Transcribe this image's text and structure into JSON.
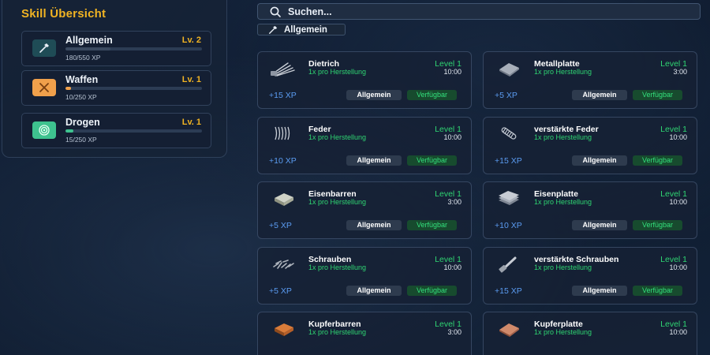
{
  "skills_panel": {
    "title": "Skill Übersicht",
    "skills": [
      {
        "name": "Allgemein",
        "level": "Lv. 2",
        "xp": "180/550 XP",
        "progress": 0.33,
        "icon": "hammer-icon",
        "icon_bg": "#1f4c56",
        "bar_color": "#3a4a60"
      },
      {
        "name": "Waffen",
        "level": "Lv. 1",
        "xp": "10/250 XP",
        "progress": 0.04,
        "icon": "crossed-swords-icon",
        "icon_bg": "#f0a04b",
        "bar_color": "#f0a04b"
      },
      {
        "name": "Drogen",
        "level": "Lv. 1",
        "xp": "15/250 XP",
        "progress": 0.06,
        "icon": "spiral-icon",
        "icon_bg": "#3ec28f",
        "bar_color": "#3ec28f"
      }
    ]
  },
  "search": {
    "placeholder": "Suchen..."
  },
  "filter": {
    "label": "Allgemein"
  },
  "items": [
    {
      "name": "Dietrich",
      "level": "Level 1",
      "per": "1x pro Herstellung",
      "time": "10:00",
      "xp": "+15 XP",
      "category": "Allgemein",
      "status": "Verfügbar",
      "thumb": "lockpick"
    },
    {
      "name": "Metallplatte",
      "level": "Level 1",
      "per": "1x pro Herstellung",
      "time": "3:00",
      "xp": "+5 XP",
      "category": "Allgemein",
      "status": "Verfügbar",
      "thumb": "plate"
    },
    {
      "name": "Feder",
      "level": "Level 1",
      "per": "1x pro Herstellung",
      "time": "10:00",
      "xp": "+10 XP",
      "category": "Allgemein",
      "status": "Verfügbar",
      "thumb": "spring"
    },
    {
      "name": "verstärkte Feder",
      "level": "Level 1",
      "per": "1x pro Herstellung",
      "time": "10:00",
      "xp": "+15 XP",
      "category": "Allgemein",
      "status": "Verfügbar",
      "thumb": "spring2"
    },
    {
      "name": "Eisenbarren",
      "level": "Level 1",
      "per": "1x pro Herstellung",
      "time": "3:00",
      "xp": "+5 XP",
      "category": "Allgemein",
      "status": "Verfügbar",
      "thumb": "ingot"
    },
    {
      "name": "Eisenplatte",
      "level": "Level 1",
      "per": "1x pro Herstellung",
      "time": "10:00",
      "xp": "+10 XP",
      "category": "Allgemein",
      "status": "Verfügbar",
      "thumb": "plates"
    },
    {
      "name": "Schrauben",
      "level": "Level 1",
      "per": "1x pro Herstellung",
      "time": "10:00",
      "xp": "+5 XP",
      "category": "Allgemein",
      "status": "Verfügbar",
      "thumb": "screws"
    },
    {
      "name": "verstärkte Schrauben",
      "level": "Level 1",
      "per": "1x pro Herstellung",
      "time": "10:00",
      "xp": "+15 XP",
      "category": "Allgemein",
      "status": "Verfügbar",
      "thumb": "bolt"
    },
    {
      "name": "Kupferbarren",
      "level": "Level 1",
      "per": "1x pro Herstellung",
      "time": "3:00",
      "xp": "",
      "category": "",
      "status": "",
      "thumb": "copper-ingot"
    },
    {
      "name": "Kupferplatte",
      "level": "Level 1",
      "per": "1x pro Herstellung",
      "time": "10:00",
      "xp": "",
      "category": "",
      "status": "",
      "thumb": "copper-plate"
    }
  ]
}
